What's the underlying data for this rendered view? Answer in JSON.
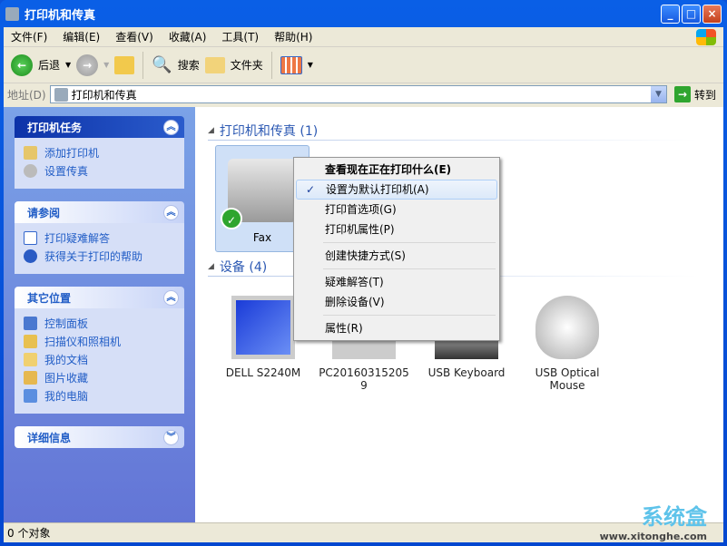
{
  "window": {
    "title": "打印机和传真",
    "minimize": "_",
    "maximize": "□",
    "close": "×"
  },
  "menu": [
    "文件(F)",
    "编辑(E)",
    "查看(V)",
    "收藏(A)",
    "工具(T)",
    "帮助(H)"
  ],
  "toolbar": {
    "back": "后退",
    "search": "搜索",
    "folders": "文件夹"
  },
  "address": {
    "label": "地址(D)",
    "value": "打印机和传真",
    "go": "转到"
  },
  "sidebar": [
    {
      "title": "打印机任务",
      "toggle": "collapse",
      "items": [
        "添加打印机",
        "设置传真"
      ]
    },
    {
      "title": "请参阅",
      "toggle": "collapse",
      "items": [
        "打印疑难解答",
        "获得关于打印的帮助"
      ]
    },
    {
      "title": "其它位置",
      "toggle": "collapse",
      "items": [
        "控制面板",
        "扫描仪和照相机",
        "我的文档",
        "图片收藏",
        "我的电脑"
      ]
    },
    {
      "title": "详细信息",
      "toggle": "expand",
      "items": []
    }
  ],
  "groups": {
    "printers": "打印机和传真 (1)",
    "devices": "设备 (4)"
  },
  "printers": [
    {
      "name": "Fax",
      "default": true
    }
  ],
  "devices": [
    {
      "name": "DELL S2240M"
    },
    {
      "name": "PC20160315205 9"
    },
    {
      "name": "USB Keyboard"
    },
    {
      "name": "USB Optical Mouse"
    }
  ],
  "context_menu": [
    {
      "label": "查看现在正在打印什么(E)",
      "bold": true
    },
    {
      "label": "设置为默认打印机(A)",
      "checked": true,
      "highlighted": true
    },
    {
      "label": "打印首选项(G)"
    },
    {
      "label": "打印机属性(P)"
    },
    {
      "label": "创建快捷方式(S)"
    },
    {
      "label": "疑难解答(T)"
    },
    {
      "label": "删除设备(V)"
    },
    {
      "label": "属性(R)"
    }
  ],
  "status": "0 个对象",
  "watermark": {
    "brand": "系统盒",
    "url": "www.xitonghe.com"
  }
}
